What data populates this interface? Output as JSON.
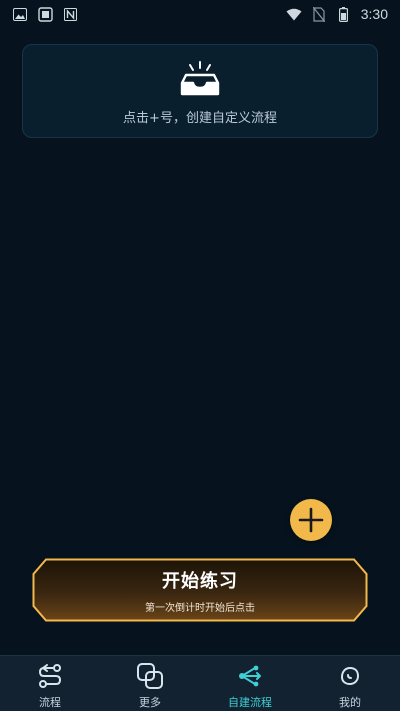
{
  "status_bar": {
    "time": "3:30",
    "icons": [
      "image-icon",
      "sim-icon",
      "notification-icon",
      "wifi-icon",
      "no-sim-icon",
      "battery-icon"
    ]
  },
  "empty_state": {
    "icon": "inbox-icon",
    "text": "点击+号，创建自定义流程"
  },
  "fab": {
    "icon": "plus-icon"
  },
  "start_button": {
    "title": "开始练习",
    "subtitle": "第一次倒计时开始后点击"
  },
  "nav": {
    "items": [
      {
        "label": "流程",
        "icon": "flow-icon"
      },
      {
        "label": "更多",
        "icon": "more-icon"
      },
      {
        "label": "自建流程",
        "icon": "custom-flow-icon"
      },
      {
        "label": "我的",
        "icon": "profile-icon"
      }
    ],
    "active_index": 2
  },
  "colors": {
    "background": "#06131e",
    "accent": "#3fd0d6",
    "fab": "#f2b84a",
    "button_border": "#f2b84a"
  }
}
